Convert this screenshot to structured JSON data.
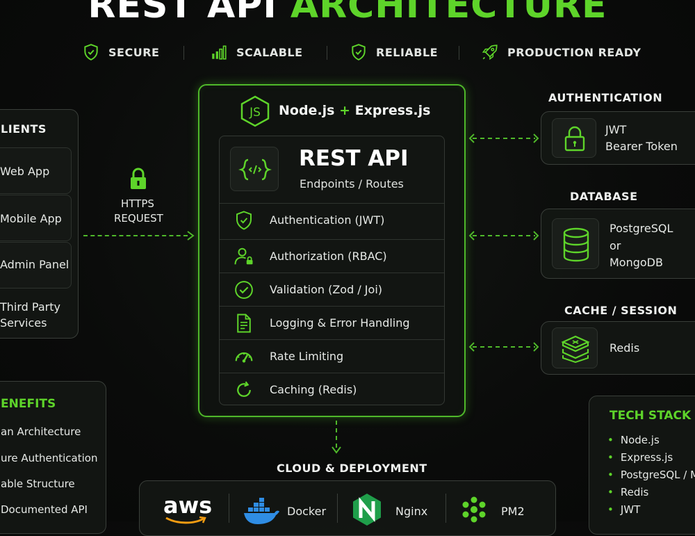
{
  "title": {
    "part1": "REST API",
    "part2": "ARCHITECTURE"
  },
  "badges": [
    {
      "icon": "shield-check-icon",
      "label": "SECURE"
    },
    {
      "icon": "bar-chart-icon",
      "label": "SCALABLE"
    },
    {
      "icon": "shield-check-icon",
      "label": "RELIABLE"
    },
    {
      "icon": "rocket-icon",
      "label": "PRODUCTION READY"
    }
  ],
  "clients": {
    "title": "LIENTS",
    "items": [
      "Web App",
      "Mobile App",
      "Admin Panel",
      "Third Party",
      "Services"
    ]
  },
  "https": {
    "line1": "HTTPS",
    "line2": "REQUEST"
  },
  "server": {
    "runtime": "Node.js",
    "plus": "+",
    "framework": "Express.js",
    "api_title": "REST API",
    "api_subtitle": "Endpoints / Routes",
    "features": [
      "Authentication (JWT)",
      "Authorization (RBAC)",
      "Validation (Zod / Joi)",
      "Logging & Error Handling",
      "Rate Limiting",
      "Caching (Redis)"
    ]
  },
  "auth": {
    "heading": "AUTHENTICATION",
    "line1": "JWT",
    "line2": "Bearer Token"
  },
  "database": {
    "heading": "DATABASE",
    "line1": "PostgreSQL",
    "line2": "or",
    "line3": "MongoDB"
  },
  "cache": {
    "heading": "CACHE / SESSION",
    "line1": "Redis"
  },
  "benefits": {
    "title": "ENEFITS",
    "items": [
      "an Architecture",
      "ure Authentication",
      "able Structure",
      "Documented API"
    ]
  },
  "techstack": {
    "title": "TECH STACK",
    "items": [
      "Node.js",
      "Express.js",
      "PostgreSQL / Mo",
      "Redis",
      "JWT"
    ]
  },
  "deploy": {
    "heading": "CLOUD & DEPLOYMENT",
    "aws": "aws",
    "docker": "Docker",
    "nginx": "Nginx",
    "pm2": "PM2"
  },
  "colors": {
    "accent": "#5ed42a",
    "background": "#0a0b0a"
  }
}
